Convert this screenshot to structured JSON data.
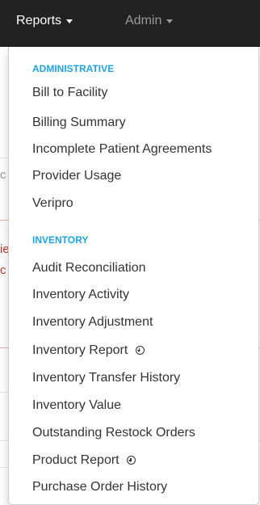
{
  "navbar": {
    "reports_label": "Reports",
    "admin_label": "Admin"
  },
  "background": {
    "left_fragments": [
      "c",
      "ie",
      "c"
    ]
  },
  "dropdown": {
    "administrative_header": "ADMINISTRATIVE",
    "administrative_items": [
      "Bill to Facility",
      "Billing Summary",
      "Incomplete Patient Agreements",
      "Provider Usage",
      "Veripro"
    ],
    "inventory_header": "INVENTORY",
    "inventory_items": [
      "Audit Reconciliation",
      "Inventory Activity",
      "Inventory Adjustment",
      "Inventory Report",
      "Inventory Transfer History",
      "Inventory Value",
      "Outstanding Restock Orders",
      "Product Report",
      "Purchase Order History"
    ]
  },
  "colors": {
    "navbar_bg": "#222222",
    "section_header": "#1fa3e0",
    "item_text": "#333333",
    "background_accent": "#c0392b"
  },
  "icons": {
    "download": "download-circle-icon",
    "caret": "caret-down-icon"
  }
}
